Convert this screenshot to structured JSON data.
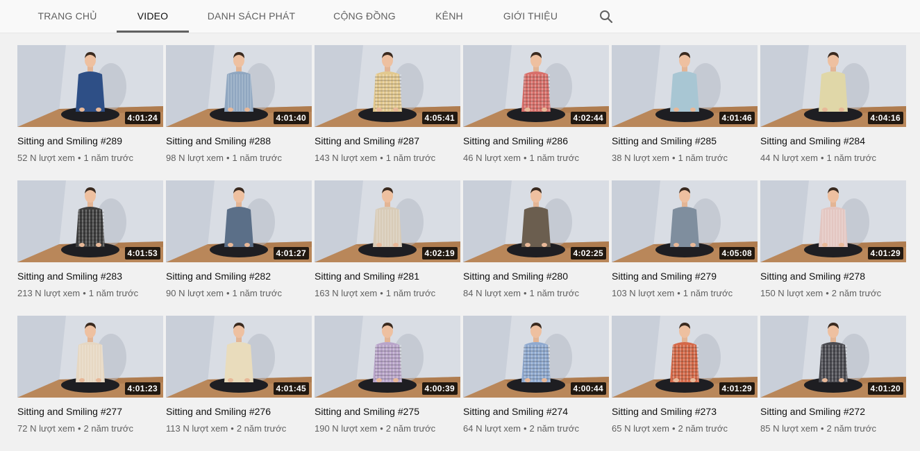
{
  "tabs": [
    {
      "label": "TRANG CHỦ",
      "active": false
    },
    {
      "label": "VIDEO",
      "active": true
    },
    {
      "label": "DANH SÁCH PHÁT",
      "active": false
    },
    {
      "label": "CỘNG ĐỒNG",
      "active": false
    },
    {
      "label": "KÊNH",
      "active": false
    },
    {
      "label": "GIỚI THIỆU",
      "active": false
    }
  ],
  "search_icon": "search-icon",
  "meta_separator": "•",
  "videos": [
    {
      "title": "Sitting and Smiling #289",
      "duration": "4:01:24",
      "views": "52 N lượt xem",
      "age": "1 năm trước",
      "shirt_color": "#2e4f86",
      "shirt_pattern": "solid"
    },
    {
      "title": "Sitting and Smiling #288",
      "duration": "4:01:40",
      "views": "98 N lượt xem",
      "age": "1 năm trước",
      "shirt_color": "#8fa6c0",
      "shirt_pattern": "stripe"
    },
    {
      "title": "Sitting and Smiling #287",
      "duration": "4:05:41",
      "views": "143 N lượt xem",
      "age": "1 năm trước",
      "shirt_color": "#e2c88e",
      "shirt_pattern": "check"
    },
    {
      "title": "Sitting and Smiling #286",
      "duration": "4:02:44",
      "views": "46 N lượt xem",
      "age": "1 năm trước",
      "shirt_color": "#d86f6a",
      "shirt_pattern": "check"
    },
    {
      "title": "Sitting and Smiling #285",
      "duration": "4:01:46",
      "views": "38 N lượt xem",
      "age": "1 năm trước",
      "shirt_color": "#a8c6d3",
      "shirt_pattern": "solid"
    },
    {
      "title": "Sitting and Smiling #284",
      "duration": "4:04:16",
      "views": "44 N lượt xem",
      "age": "1 năm trước",
      "shirt_color": "#e0d7a8",
      "shirt_pattern": "solid"
    },
    {
      "title": "Sitting and Smiling #283",
      "duration": "4:01:53",
      "views": "213 N lượt xem",
      "age": "1 năm trước",
      "shirt_color": "#3d3d3d",
      "shirt_pattern": "check"
    },
    {
      "title": "Sitting and Smiling #282",
      "duration": "4:01:27",
      "views": "90 N lượt xem",
      "age": "1 năm trước",
      "shirt_color": "#5b6f88",
      "shirt_pattern": "solid"
    },
    {
      "title": "Sitting and Smiling #281",
      "duration": "4:02:19",
      "views": "163 N lượt xem",
      "age": "1 năm trước",
      "shirt_color": "#d8cbb7",
      "shirt_pattern": "stripe"
    },
    {
      "title": "Sitting and Smiling #280",
      "duration": "4:02:25",
      "views": "84 N lượt xem",
      "age": "1 năm trước",
      "shirt_color": "#6b5e4f",
      "shirt_pattern": "solid"
    },
    {
      "title": "Sitting and Smiling #279",
      "duration": "4:05:08",
      "views": "103 N lượt xem",
      "age": "1 năm trước",
      "shirt_color": "#7f8e9e",
      "shirt_pattern": "solid"
    },
    {
      "title": "Sitting and Smiling #278",
      "duration": "4:01:29",
      "views": "150 N lượt xem",
      "age": "2 năm trước",
      "shirt_color": "#e3c6c1",
      "shirt_pattern": "stripe"
    },
    {
      "title": "Sitting and Smiling #277",
      "duration": "4:01:23",
      "views": "72 N lượt xem",
      "age": "2 năm trước",
      "shirt_color": "#e6d7c2",
      "shirt_pattern": "stripe"
    },
    {
      "title": "Sitting and Smiling #276",
      "duration": "4:01:45",
      "views": "113 N lượt xem",
      "age": "2 năm trước",
      "shirt_color": "#e9dcbc",
      "shirt_pattern": "solid"
    },
    {
      "title": "Sitting and Smiling #275",
      "duration": "4:00:39",
      "views": "190 N lượt xem",
      "age": "2 năm trước",
      "shirt_color": "#b8a4c9",
      "shirt_pattern": "check"
    },
    {
      "title": "Sitting and Smiling #274",
      "duration": "4:00:44",
      "views": "64 N lượt xem",
      "age": "2 năm trước",
      "shirt_color": "#8fa9cf",
      "shirt_pattern": "check"
    },
    {
      "title": "Sitting and Smiling #273",
      "duration": "4:01:29",
      "views": "65 N lượt xem",
      "age": "2 năm trước",
      "shirt_color": "#d46848",
      "shirt_pattern": "check"
    },
    {
      "title": "Sitting and Smiling #272",
      "duration": "4:01:20",
      "views": "85 N lượt xem",
      "age": "2 năm trước",
      "shirt_color": "#4a4a50",
      "shirt_pattern": "check"
    }
  ]
}
